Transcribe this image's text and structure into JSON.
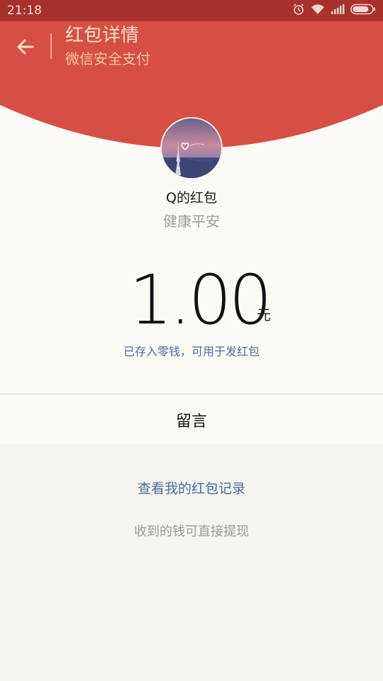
{
  "status_bar": {
    "time": "21:18",
    "icons": [
      "alarm-icon",
      "wifi-icon",
      "signal-icon",
      "battery-icon"
    ]
  },
  "header": {
    "title": "红包详情",
    "subtitle": "微信安全支付",
    "back_icon": "arrow-left-icon",
    "background_color": "#d64f45"
  },
  "packet": {
    "sender": "Q的红包",
    "wish": "健康平安",
    "amount": "1.00",
    "unit": "元",
    "note": "已存入零钱，可用于发红包"
  },
  "message_label": "留言",
  "footer": {
    "records_link": "查看我的红包记录",
    "withdraw_tip": "收到的钱可直接提现"
  },
  "colors": {
    "status_bar": "#a8312d",
    "link": "#4a6b9a",
    "muted": "#9e9e9e"
  }
}
